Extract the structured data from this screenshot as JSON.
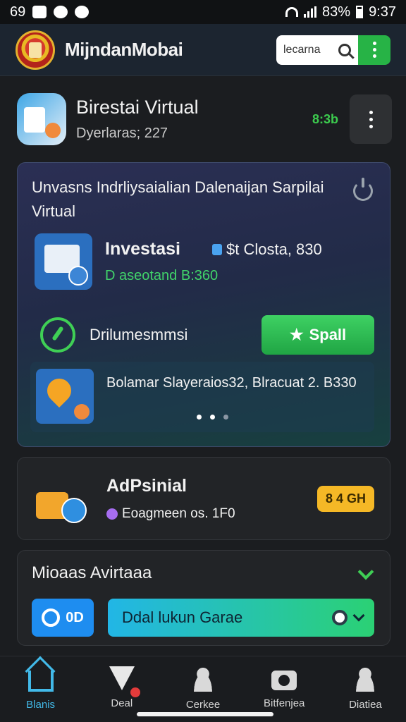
{
  "status_bar": {
    "time_left": "69",
    "battery": "83%",
    "time_right": "9:37"
  },
  "header": {
    "app_title": "MijndanMobai",
    "search": {
      "placeholder": "",
      "value": "lecarna"
    }
  },
  "profile": {
    "name": "Birestai Virtual",
    "subtitle": "Dyerlaras; 227",
    "badge": "8:3b"
  },
  "main_card": {
    "title": "Unvasns Indrliysaialian Dalenaijan Sarpilai Virtual",
    "invest": {
      "label": "Investasi",
      "cost": "$t Closta, 830",
      "sub": "D aseotand B:360"
    },
    "action": {
      "label": "Drilumesmmsi",
      "button": "Spall"
    },
    "promo": {
      "text": "Bolamar Slayeraios32, Blracuat 2. B330"
    }
  },
  "ad_card": {
    "title": "AdPsinial",
    "subtitle": "Eoagmeen os. 1F0",
    "badge": "8 4 GH"
  },
  "section": {
    "title": "Mioaas Avirtaaa",
    "toggle_label": "0D",
    "game_button": "Ddal lukun Garae"
  },
  "bottom_nav": {
    "items": [
      {
        "label": "Blanis",
        "icon": "home-icon"
      },
      {
        "label": "Deal",
        "icon": "deal-icon"
      },
      {
        "label": "Cerkee",
        "icon": "person-icon"
      },
      {
        "label": "Bitfenjea",
        "icon": "camera-icon"
      },
      {
        "label": "Diatiea",
        "icon": "person-icon"
      }
    ]
  },
  "colors": {
    "accent_green": "#27b346",
    "accent_blue": "#1e8df0",
    "badge_yellow": "#f5b826"
  }
}
